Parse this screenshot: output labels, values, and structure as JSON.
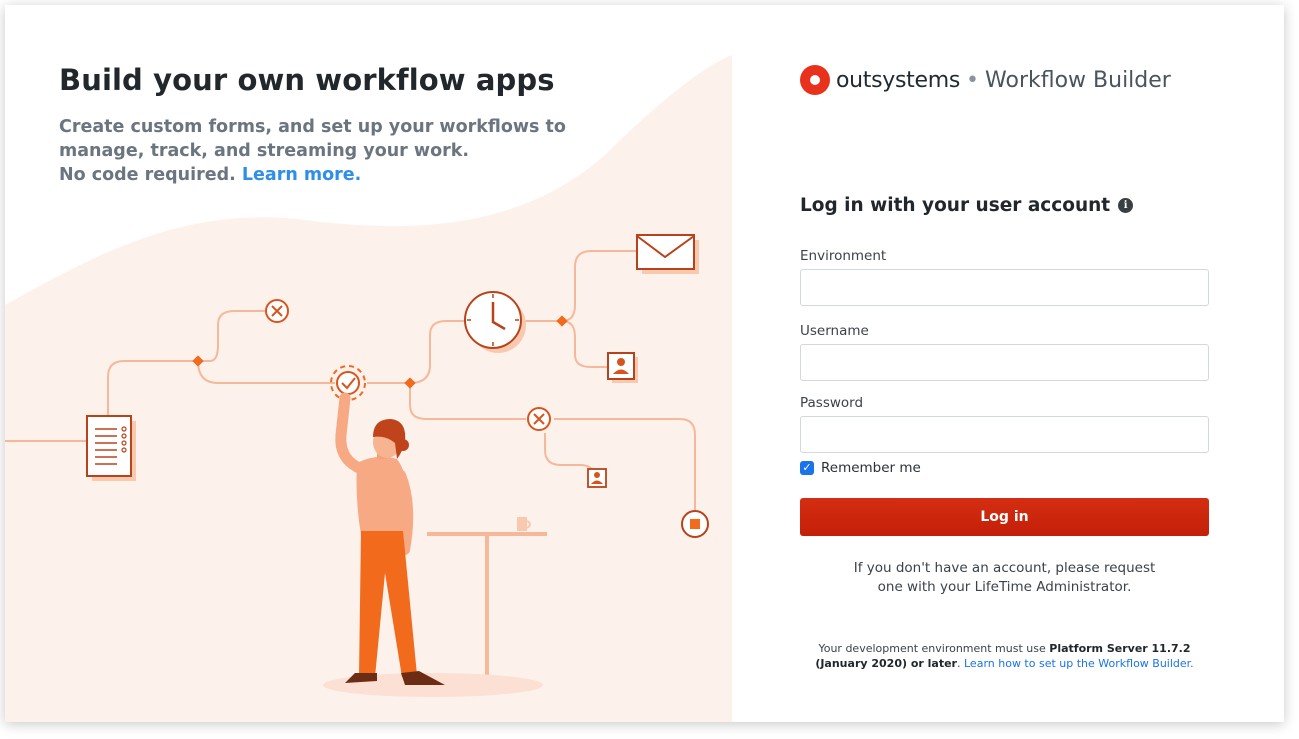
{
  "promo": {
    "title": "Build your own workflow apps",
    "desc_line1": "Create custom forms, and set up your workflows to",
    "desc_line2": "manage, track, and streaming your work.",
    "desc_line3": "No code required.",
    "learn_more": "Learn more."
  },
  "brand": {
    "name": "outsystems",
    "separator": "•",
    "product": "Workflow Builder"
  },
  "login": {
    "heading": "Log in with your user account",
    "environment_label": "Environment",
    "environment_value": "",
    "username_label": "Username",
    "username_value": "",
    "password_label": "Password",
    "password_value": "",
    "remember_label": "Remember me",
    "remember_checked": true,
    "button_label": "Log in",
    "note_line1": "If you don't have an account, please request",
    "note_line2": "one with your LifeTime Administrator.",
    "footer_prefix": "Your development environment must use",
    "footer_bold": "Platform Server 11.7.2 (January 2020) or later",
    "footer_suffix": ".",
    "footer_link": "Learn how to set up the Workflow Builder."
  },
  "colors": {
    "accent_red": "#d42d12",
    "illustration_orange": "#f26a1b",
    "link_blue": "#2f8ee8",
    "illustration_bg": "#fdf1ec"
  }
}
